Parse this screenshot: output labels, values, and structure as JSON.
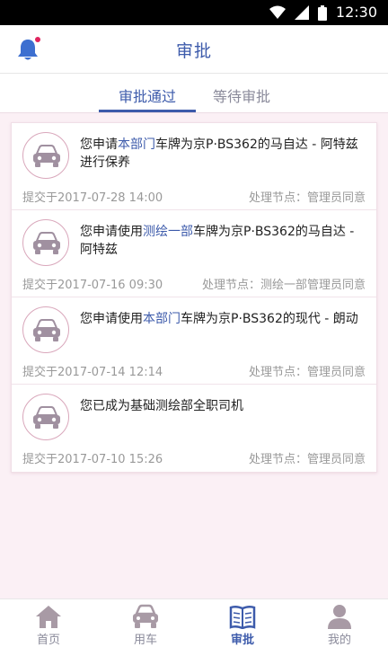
{
  "status_bar": {
    "time": "12:30"
  },
  "header": {
    "title": "审批"
  },
  "tabs": [
    {
      "label": "审批通过",
      "active": true
    },
    {
      "label": "等待审批",
      "active": false
    }
  ],
  "items": [
    {
      "message_prefix": "您申请",
      "message_highlight": "本部门",
      "message_suffix": "车牌为京P·BS362的马自达 - 阿特兹进行保养",
      "submitted": "提交于2017-07-28 14:00",
      "node": "处理节点：管理员同意"
    },
    {
      "message_prefix": "您申请使用",
      "message_highlight": "测绘一部",
      "message_suffix": "车牌为京P·BS362的马自达 - 阿特兹",
      "submitted": "提交于2017-07-16 09:30",
      "node": "处理节点：测绘一部管理员同意"
    },
    {
      "message_prefix": "您申请使用",
      "message_highlight": "本部门",
      "message_suffix": "车牌为京P·BS362的现代 - 朗动",
      "submitted": "提交于2017-07-14 12:14",
      "node": "处理节点：管理员同意"
    },
    {
      "message_prefix": "您已成为基础测绘部全职司机",
      "message_highlight": "",
      "message_suffix": "",
      "submitted": "提交于2017-07-10 15:26",
      "node": "处理节点：管理员同意"
    }
  ],
  "bottom_nav": [
    {
      "label": "首页",
      "icon": "home-icon",
      "active": false
    },
    {
      "label": "用车",
      "icon": "car-icon",
      "active": false
    },
    {
      "label": "审批",
      "icon": "book-icon",
      "active": true
    },
    {
      "label": "我的",
      "icon": "person-icon",
      "active": false
    }
  ],
  "colors": {
    "accent": "#3d5bab",
    "background": "#fbf0f5",
    "icon_border": "#d9a7bb",
    "notification_dot": "#e0245e"
  }
}
